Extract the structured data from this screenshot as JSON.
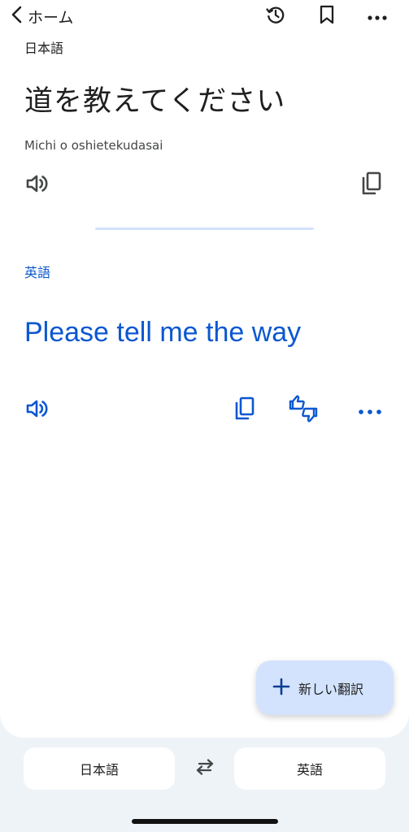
{
  "header": {
    "back_label": "ホーム",
    "icons": [
      "chevron-left-icon",
      "history-icon",
      "bookmark-icon",
      "more-icon"
    ]
  },
  "source": {
    "language": "日本語",
    "text": "道を教えてください",
    "romanization": "Michi o oshietekudasai"
  },
  "target": {
    "language": "英語",
    "text": "Please tell me the way"
  },
  "fab": {
    "label": "新しい翻訳"
  },
  "language_bar": {
    "source_label": "日本語",
    "target_label": "英語"
  },
  "colors": {
    "accent": "#0b57d0",
    "fab_bg": "#d3e3fd",
    "page_bg": "#eef3f8",
    "icon_dark": "#444746"
  }
}
